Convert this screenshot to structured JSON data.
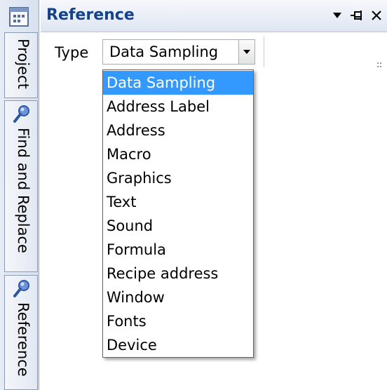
{
  "panel": {
    "title": "Reference",
    "controls": {
      "dropdown_icon": "triangle-down-icon",
      "pin_icon": "pin-icon",
      "close_icon": "close-icon"
    }
  },
  "side_tabs": [
    {
      "label": "Project",
      "icon": "project-icon"
    },
    {
      "label": "Find and Replace",
      "icon": "magnifier-icon"
    },
    {
      "label": "Reference",
      "icon": "magnifier-icon"
    }
  ],
  "toolbar": {
    "type_label": "Type",
    "type_value": "Data Sampling"
  },
  "dropdown": {
    "selected_index": 0,
    "options": [
      "Data Sampling",
      "Address Label",
      "Address",
      "Macro",
      "Graphics",
      "Text",
      "Sound",
      "Formula",
      "Recipe address",
      "Window",
      "Fonts",
      "Device"
    ]
  },
  "colors": {
    "title_text": "#15428b",
    "selection": "#3399ff"
  }
}
